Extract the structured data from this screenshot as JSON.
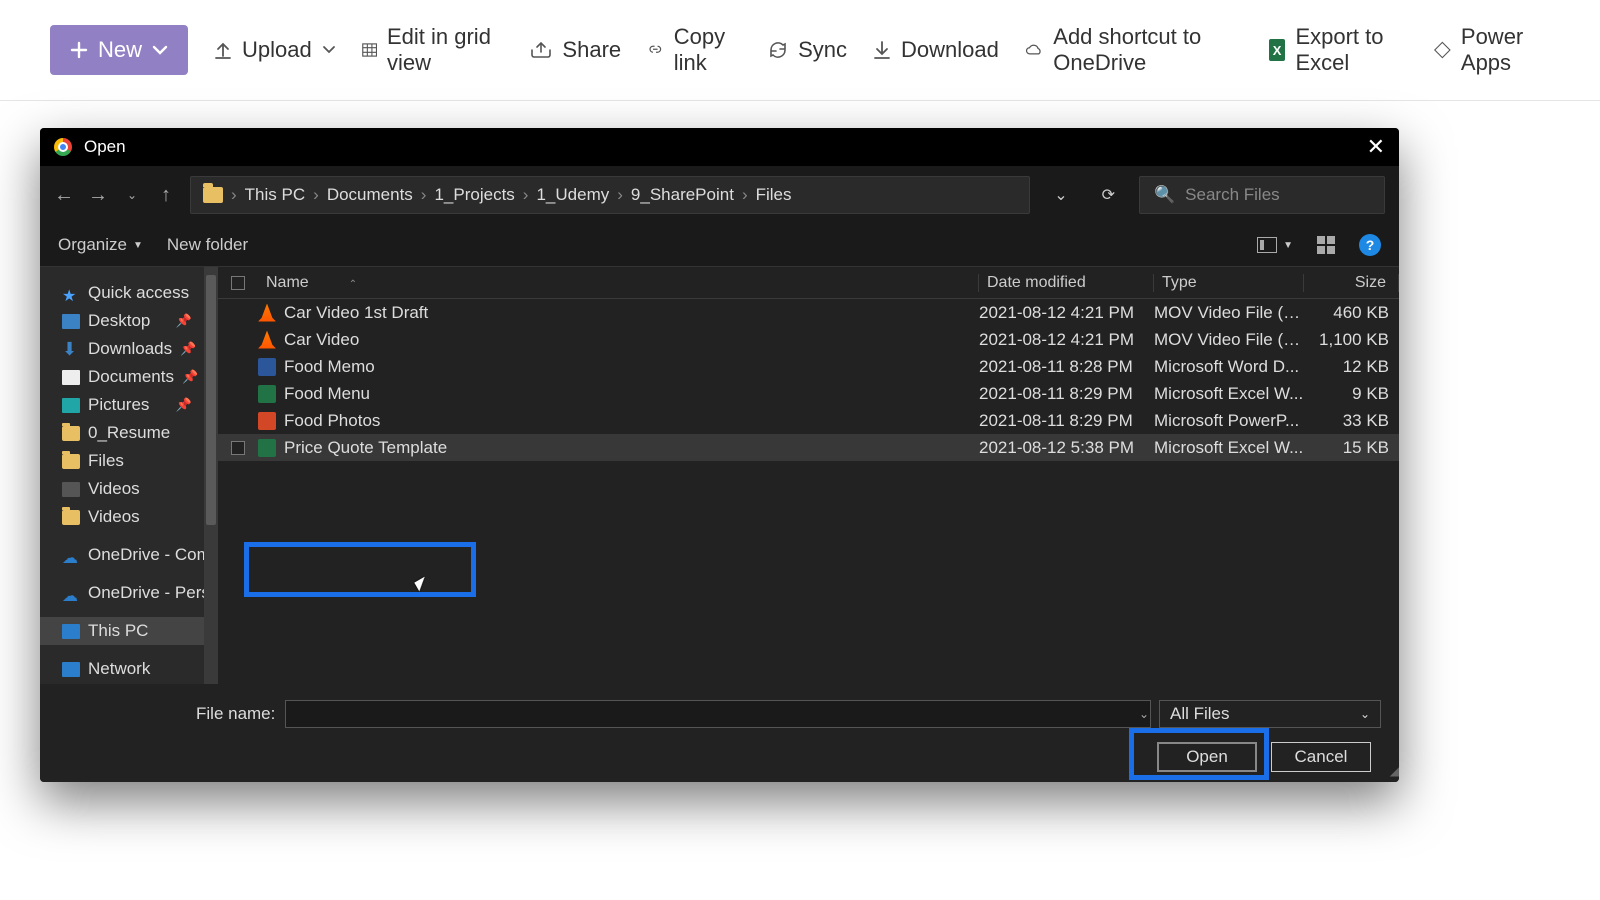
{
  "sp": {
    "new": "New",
    "upload": "Upload",
    "edit_grid": "Edit in grid view",
    "share": "Share",
    "copy_link": "Copy link",
    "sync": "Sync",
    "download": "Download",
    "shortcut": "Add shortcut to OneDrive",
    "export": "Export to Excel",
    "power": "Power Apps"
  },
  "dialog": {
    "title": "Open",
    "breadcrumb": [
      "This PC",
      "Documents",
      "1_Projects",
      "1_Udemy",
      "9_SharePoint",
      "Files"
    ],
    "search_placeholder": "Search Files",
    "organize": "Organize",
    "new_folder": "New folder",
    "columns": {
      "name": "Name",
      "date": "Date modified",
      "type": "Type",
      "size": "Size"
    },
    "tree": [
      {
        "label": "Quick access",
        "icon": "star",
        "pinned": false
      },
      {
        "label": "Desktop",
        "icon": "desk",
        "pinned": true
      },
      {
        "label": "Downloads",
        "icon": "down",
        "pinned": true
      },
      {
        "label": "Documents",
        "icon": "doc",
        "pinned": true
      },
      {
        "label": "Pictures",
        "icon": "pic",
        "pinned": true
      },
      {
        "label": "0_Resume",
        "icon": "folder",
        "pinned": false
      },
      {
        "label": "Files",
        "icon": "folder",
        "pinned": false
      },
      {
        "label": "Videos",
        "icon": "vid",
        "pinned": false
      },
      {
        "label": "Videos",
        "icon": "folder",
        "pinned": false
      },
      {
        "label": "OneDrive - Comp",
        "icon": "cloud",
        "pinned": false
      },
      {
        "label": "OneDrive - Persor",
        "icon": "cloud",
        "pinned": false
      },
      {
        "label": "This PC",
        "icon": "pc",
        "pinned": false,
        "selected": true
      },
      {
        "label": "Network",
        "icon": "pc",
        "pinned": false
      }
    ],
    "rows": [
      {
        "name": "Car Video 1st Draft",
        "date": "2021-08-12 4:21 PM",
        "type": "MOV Video File (V...",
        "size": "460 KB",
        "icon": "vlc"
      },
      {
        "name": "Car Video",
        "date": "2021-08-12 4:21 PM",
        "type": "MOV Video File (V...",
        "size": "1,100 KB",
        "icon": "vlc"
      },
      {
        "name": "Food Memo",
        "date": "2021-08-11 8:28 PM",
        "type": "Microsoft Word D...",
        "size": "12 KB",
        "icon": "word"
      },
      {
        "name": "Food Menu",
        "date": "2021-08-11 8:29 PM",
        "type": "Microsoft Excel W...",
        "size": "9 KB",
        "icon": "excel"
      },
      {
        "name": "Food Photos",
        "date": "2021-08-11 8:29 PM",
        "type": "Microsoft PowerP...",
        "size": "33 KB",
        "icon": "ppt"
      },
      {
        "name": "Price Quote Template",
        "date": "2021-08-12 5:38 PM",
        "type": "Microsoft Excel W...",
        "size": "15 KB",
        "icon": "excel",
        "selected": true
      }
    ],
    "file_name_label": "File name:",
    "file_name_value": "",
    "filter": "All Files",
    "open": "Open",
    "cancel": "Cancel"
  }
}
